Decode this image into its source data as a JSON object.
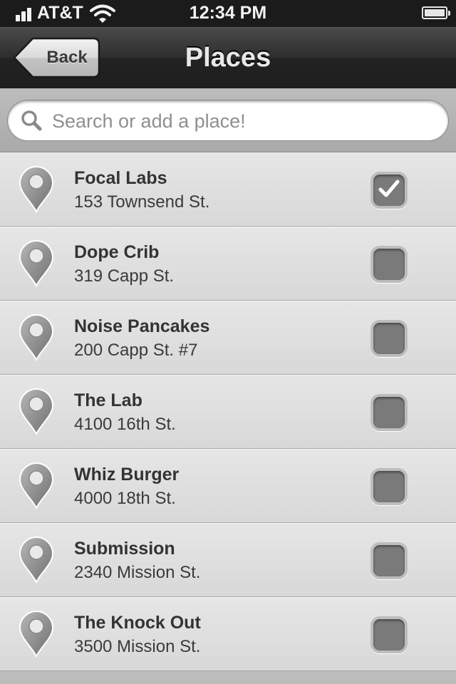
{
  "status_bar": {
    "carrier": "AT&T",
    "time": "12:34 PM",
    "battery_level": 1.0
  },
  "nav_bar": {
    "back_label": "Back",
    "title": "Places"
  },
  "search": {
    "placeholder": "Search or add a place!",
    "value": ""
  },
  "places": [
    {
      "name": "Focal Labs",
      "address": "153 Townsend St.",
      "checked": true
    },
    {
      "name": "Dope Crib",
      "address": "319 Capp St.",
      "checked": false
    },
    {
      "name": "Noise Pancakes",
      "address": "200 Capp St. #7",
      "checked": false
    },
    {
      "name": "The Lab",
      "address": "4100 16th St.",
      "checked": false
    },
    {
      "name": "Whiz Burger",
      "address": "4000 18th St.",
      "checked": false
    },
    {
      "name": "Submission",
      "address": "2340 Mission St.",
      "checked": false
    },
    {
      "name": "The Knock Out",
      "address": "3500 Mission St.",
      "checked": false
    }
  ],
  "icons": {
    "signal": "signal-bars-icon",
    "wifi": "wifi-icon",
    "battery": "battery-icon",
    "search": "search-icon",
    "place": "map-pin-icon",
    "check": "checkmark-icon"
  },
  "colors": {
    "navbar": "#2e2e2e",
    "row_background": "#e0e0e0",
    "text": "#333333",
    "checkbox": "#7a7a7a"
  }
}
